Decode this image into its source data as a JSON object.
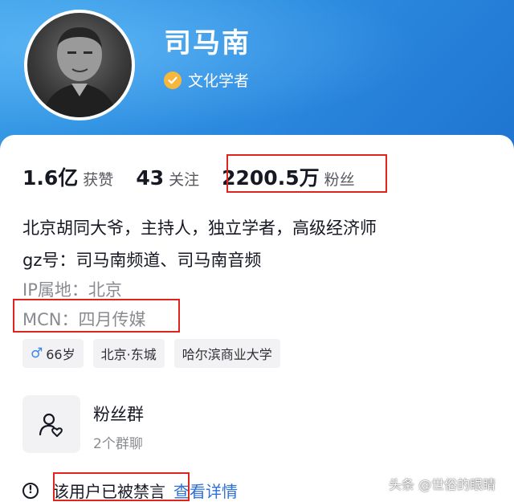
{
  "profile": {
    "name": "司马南",
    "verified_label": "文化学者"
  },
  "stats": [
    {
      "num": "1.6亿",
      "label": "获赞"
    },
    {
      "num": "43",
      "label": "关注"
    },
    {
      "num": "2200.5万",
      "label": "粉丝"
    }
  ],
  "bio": {
    "line1": "北京胡同大爷，主持人，独立学者，高级经济师",
    "line2": "gz号：司马南频道、司马南音频",
    "ip": "IP属地：北京",
    "mcn": "MCN：四月传媒"
  },
  "tags": {
    "gender_symbol": "♂",
    "age": "66岁",
    "location": "北京·东城",
    "school": "哈尔滨商业大学"
  },
  "group": {
    "title": "粉丝群",
    "subtitle": "2个群聊"
  },
  "ban": {
    "icon_glyph": "!",
    "text": "该用户已被禁言",
    "link": "查看详情"
  },
  "watermark": "头条 @世俗的眼睛",
  "colors": {
    "header_gradient_start": "#3aa0e8",
    "header_gradient_end": "#1f74d0",
    "highlight_box": "#e0231c",
    "verified_badge": "#f6b73c",
    "link": "#2e6fd8"
  },
  "icons": {
    "verified": "verified-check-icon",
    "gender": "male-icon",
    "group": "fans-group-icon",
    "ban": "exclamation-circle-icon"
  }
}
